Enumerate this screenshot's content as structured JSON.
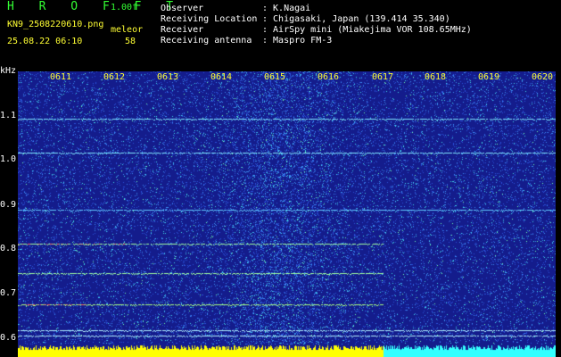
{
  "header": {
    "app_title": "H R O F F T",
    "version": "1.00f",
    "file_name": "KN9_2508220610.png",
    "mode": "meleor",
    "timestamp": "25.08.22 06:10",
    "count": "58"
  },
  "info": {
    "observer_label": "Observer",
    "observer_value": ": K.Nagai",
    "location_label": "Receiving Location",
    "location_value": ": Chigasaki, Japan (139.414 35.340)",
    "receiver_label": "Receiver",
    "receiver_value": ": AirSpy mini (Miakejima VOR 108.65MHz)",
    "antenna_label": "Receiving antenna",
    "antenna_value": ": Maspro FM-3"
  },
  "axis": {
    "unit": "kHz",
    "time_ticks": [
      "0611",
      "0612",
      "0613",
      "0614",
      "0615",
      "0616",
      "0617",
      "0618",
      "0619",
      "0620"
    ],
    "freq_ticks": [
      "1.1",
      "1.0",
      "0.9",
      "0.8",
      "0.7",
      "0.6"
    ]
  },
  "colors": {
    "background": "#000000",
    "spectrum_bg": "#141c8c",
    "text_green": "#33ff33",
    "text_yellow": "#ffff33",
    "text_white": "#ffffff",
    "bar_yellow": "#ffff00",
    "bar_cyan": "#33ffff"
  }
}
